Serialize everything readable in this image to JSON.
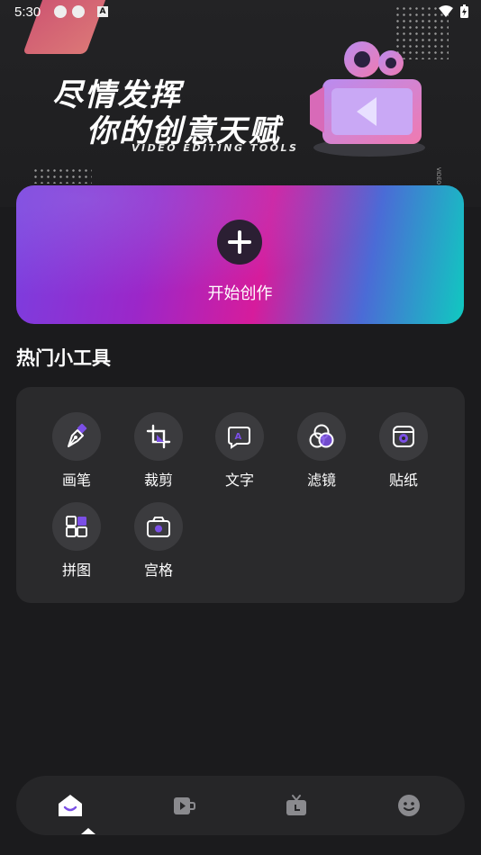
{
  "status_bar": {
    "time": "5:30"
  },
  "hero": {
    "line1": "尽情发挥",
    "line2": "你的创意天赋",
    "subtitle": "VIDEO EDITING TOOLS"
  },
  "create": {
    "label": "开始创作",
    "icon": "plus-icon"
  },
  "section": {
    "title": "热门小工具"
  },
  "tools": [
    {
      "label": "画笔",
      "icon": "pen-icon"
    },
    {
      "label": "裁剪",
      "icon": "crop-icon"
    },
    {
      "label": "文字",
      "icon": "text-bubble-icon"
    },
    {
      "label": "滤镜",
      "icon": "filter-icon"
    },
    {
      "label": "贴纸",
      "icon": "sticker-icon"
    },
    {
      "label": "拼图",
      "icon": "collage-icon"
    },
    {
      "label": "宫格",
      "icon": "grid-camera-icon"
    }
  ],
  "bottom_nav": {
    "items": [
      {
        "icon": "home-icon",
        "active": true
      },
      {
        "icon": "video-icon",
        "active": false
      },
      {
        "icon": "tv-icon",
        "active": false
      },
      {
        "icon": "face-icon",
        "active": false
      }
    ]
  },
  "colors": {
    "accent": "#7b4fe6",
    "background": "#1b1b1d",
    "panel": "#2a2a2c"
  }
}
